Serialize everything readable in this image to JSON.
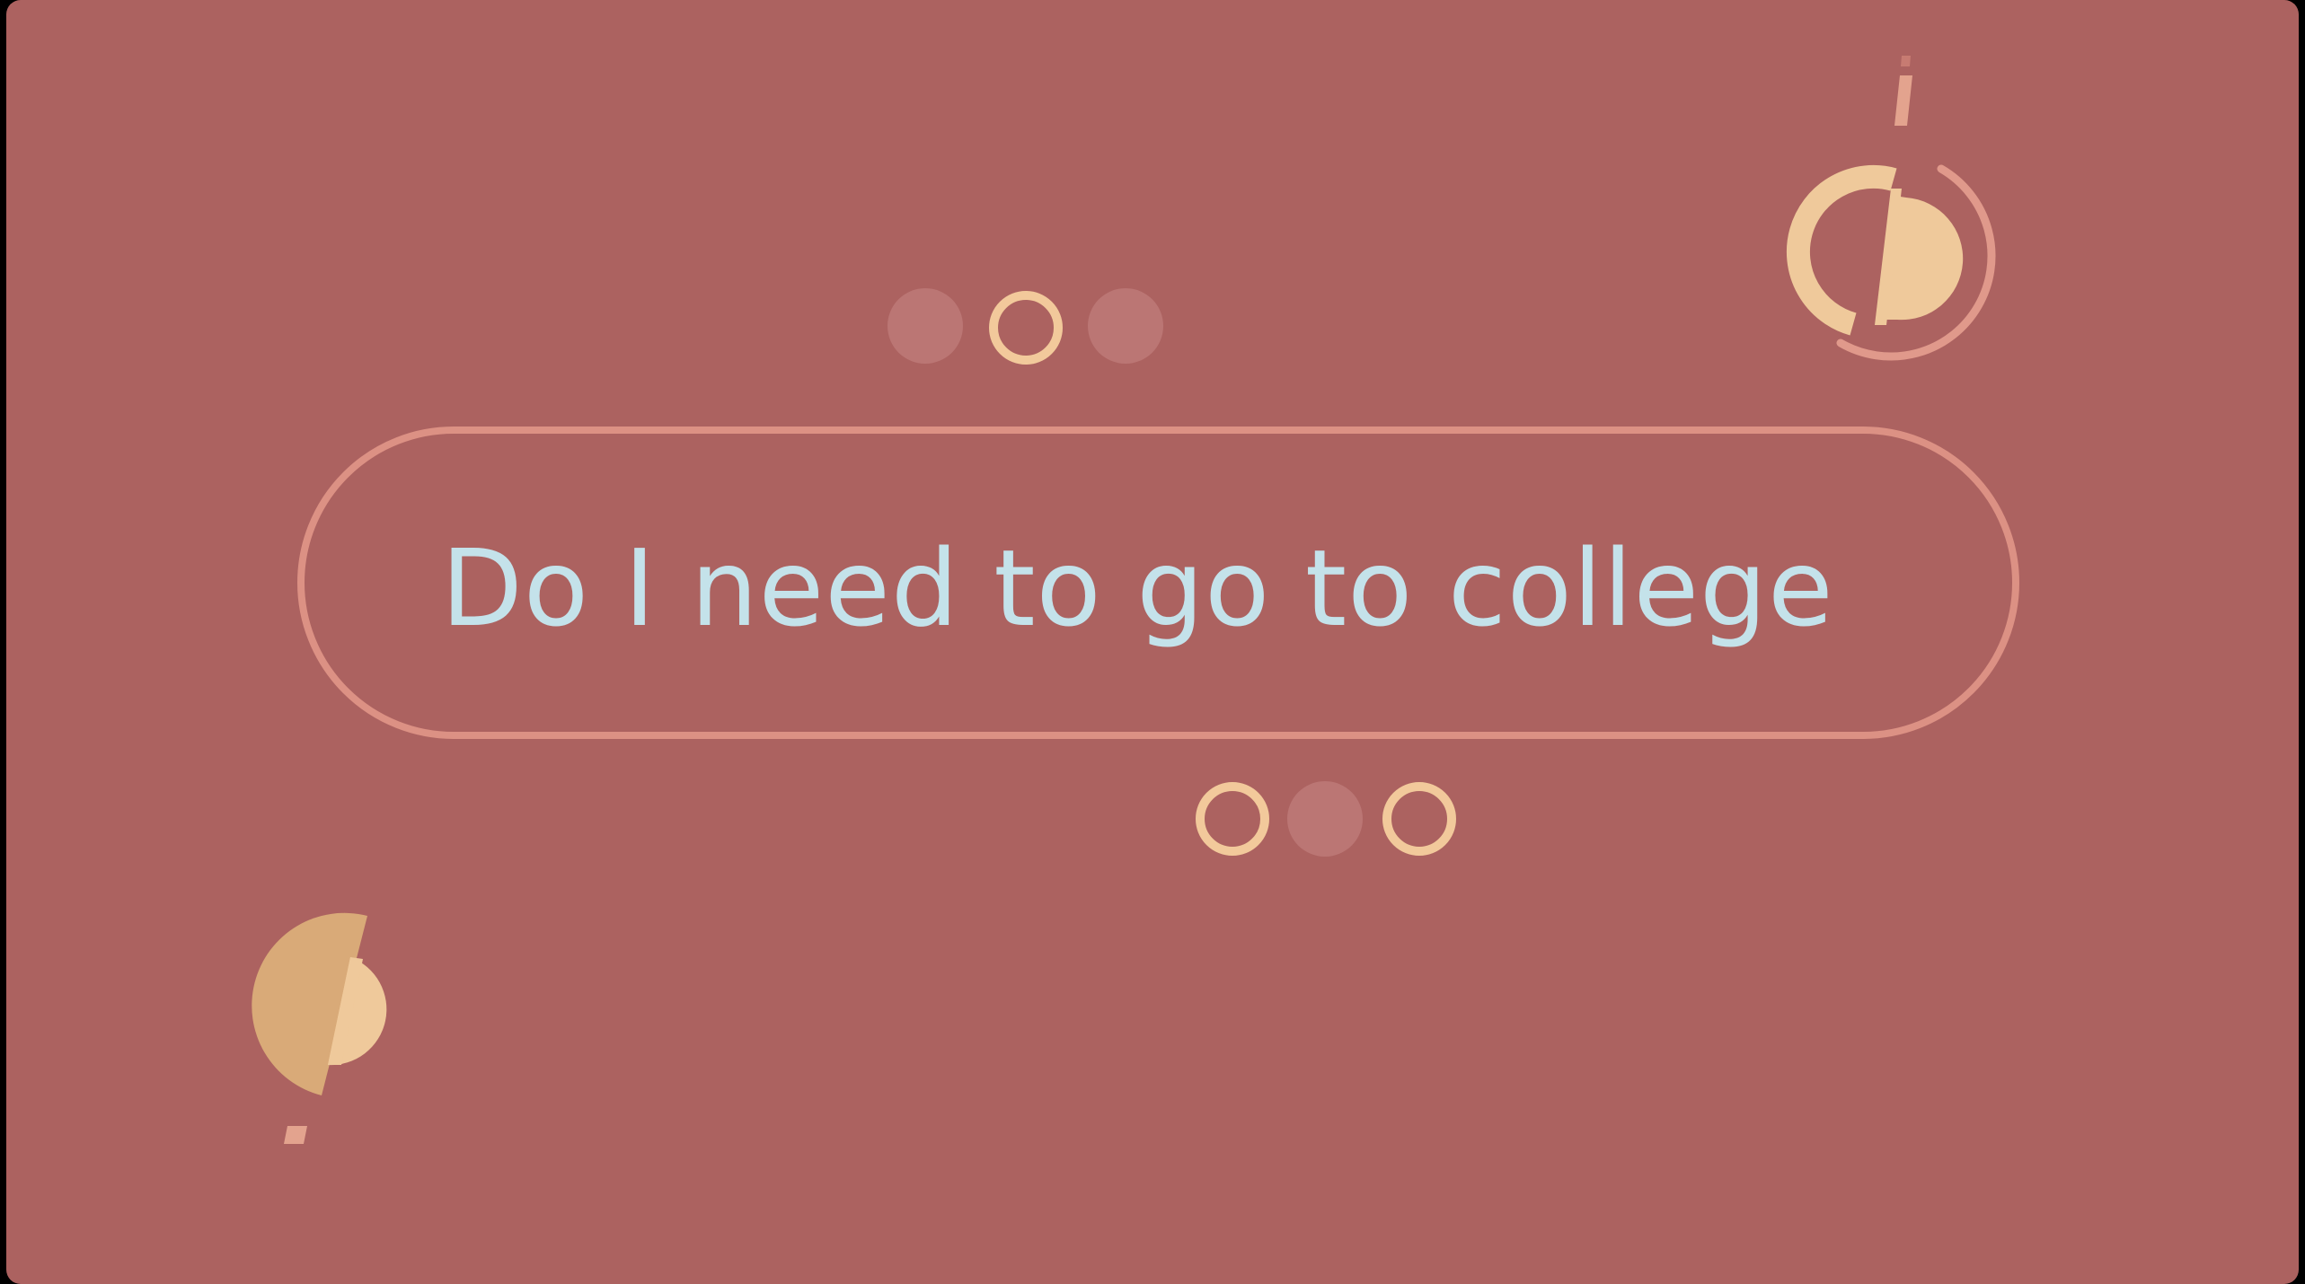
{
  "title": "Do I need to go to college",
  "colors": {
    "background": "#ac6260",
    "pill_border": "#dc9184",
    "title_text": "#c4e2ea",
    "dot_filled": "#bb7674",
    "dot_ring": "#f2c99b",
    "accent_light": "#efc99b",
    "accent_dark": "#d9aa78",
    "accent_pink": "#dc9184"
  },
  "decorations": {
    "top_dots": [
      "filled",
      "ring",
      "filled"
    ],
    "bottom_dots": [
      "ring",
      "filled",
      "ring"
    ],
    "top_right_icon": "split-circle-icon",
    "bottom_left_icon": "half-circle-icon"
  }
}
